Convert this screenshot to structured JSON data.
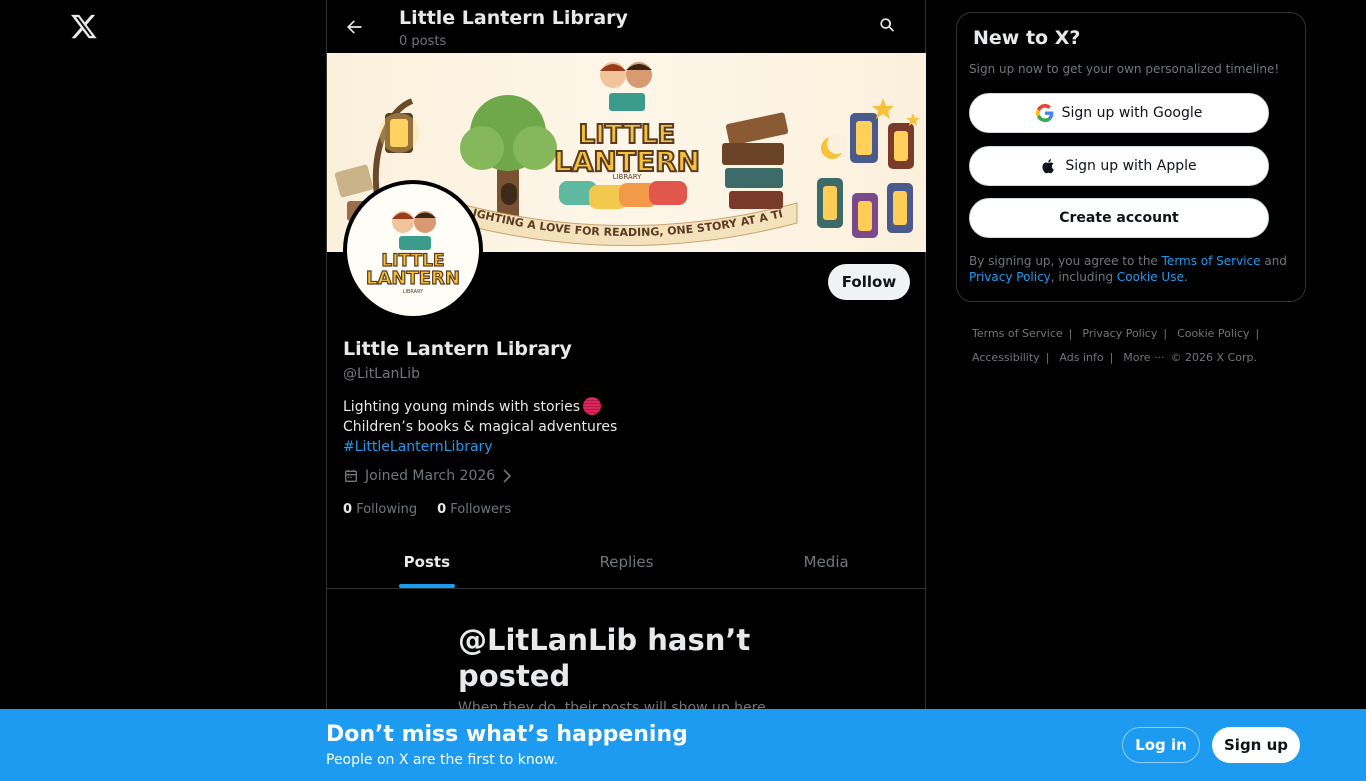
{
  "brand": {
    "logo_icon": "x-logo-icon"
  },
  "header": {
    "title": "Little Lantern Library",
    "subtitle": "0 posts"
  },
  "banner": {
    "logo_line1": "LITTLE",
    "logo_line2": "LANTERN",
    "logo_line3": "LIBRARY",
    "tagline": "IGHTING A LOVE FOR READING, ONE STORY AT A TIME."
  },
  "avatar": {
    "line1": "LITTLE",
    "line2": "LANTERN",
    "line3": "LIBRARY"
  },
  "profile": {
    "name": "Little Lantern Library",
    "handle": "@LitLanLib",
    "bio_line1": "Lighting young minds with stories",
    "bio_line2": "Children’s books & magical adventures",
    "bio_hashtag": "#LittleLanternLibrary",
    "joined": "Joined March 2026",
    "following_count": "0",
    "following_label": "Following",
    "followers_count": "0",
    "followers_label": "Followers",
    "follow_label": "Follow"
  },
  "tabs": [
    {
      "label": "Posts",
      "active": true
    },
    {
      "label": "Replies",
      "active": false
    },
    {
      "label": "Media",
      "active": false
    }
  ],
  "empty_state": {
    "title": "@LitLanLib hasn’t posted",
    "subtitle": "When they do, their posts will show up here."
  },
  "sidebar": {
    "title": "New to X?",
    "subtitle": "Sign up now to get your own personalized timeline!",
    "google_label": "Sign up with Google",
    "apple_label": "Sign up with Apple",
    "create_label": "Create account",
    "legal_pre": "By signing up, you agree to the ",
    "terms_link": "Terms of Service",
    "legal_and": " and ",
    "privacy_link": "Privacy Policy",
    "legal_including": ", including ",
    "cookie_link": "Cookie Use."
  },
  "footer": {
    "terms": "Terms of Service",
    "privacy": "Privacy Policy",
    "cookie": "Cookie Policy",
    "accessibility": "Accessibility",
    "ads": "Ads info",
    "more": "More ···",
    "copyright": "© 2026 X Corp."
  },
  "bottom_bar": {
    "title": "Don’t miss what’s happening",
    "subtitle": "People on X are the first to know.",
    "login_label": "Log in",
    "signup_label": "Sign up"
  },
  "colors": {
    "accent": "#1d9bf0",
    "background": "#000000",
    "border": "#2f3336",
    "muted": "#71767b"
  }
}
